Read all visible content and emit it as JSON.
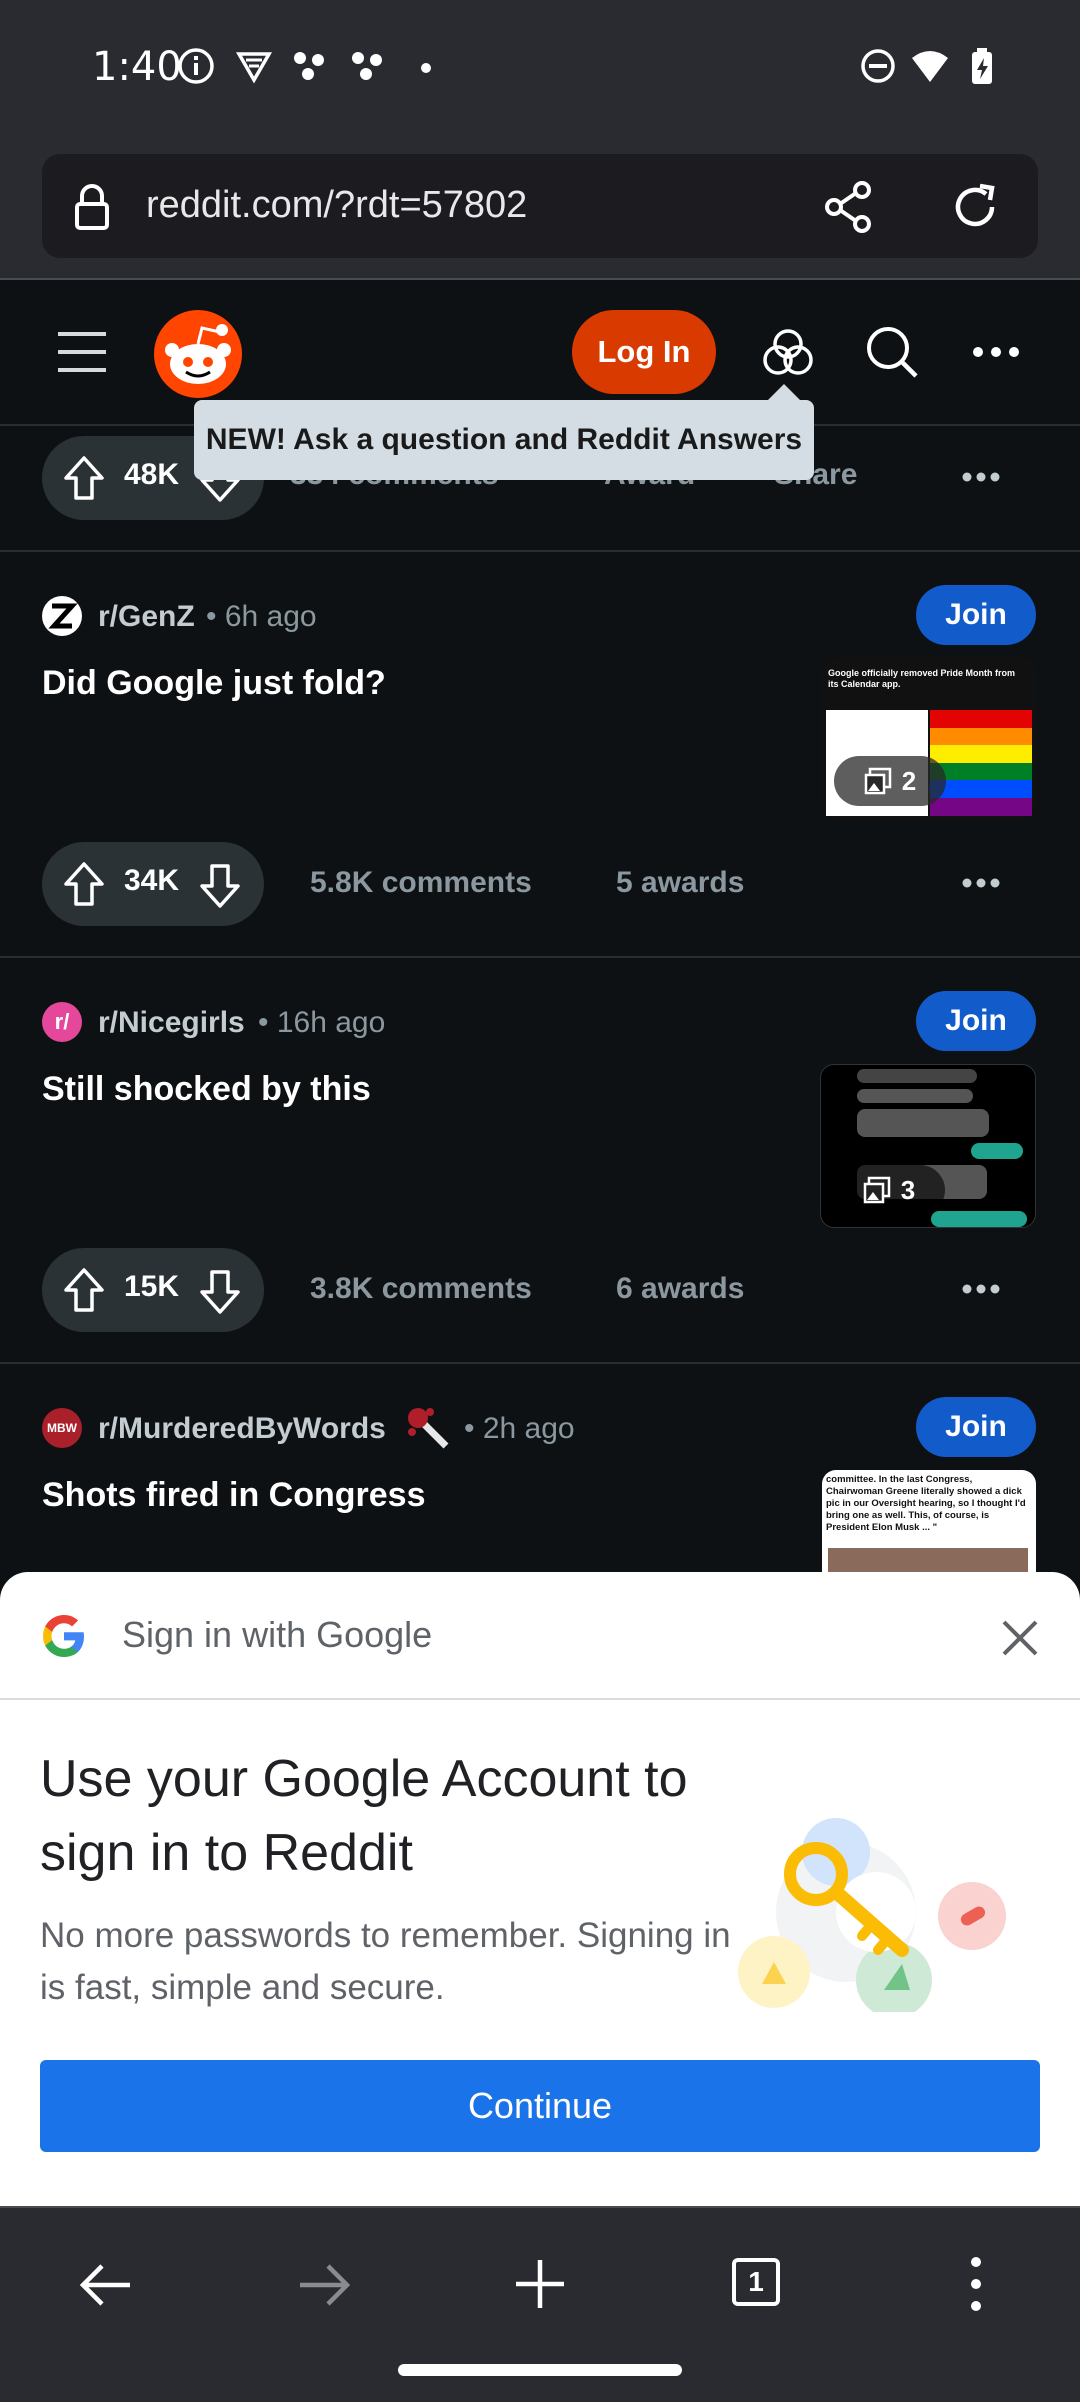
{
  "status_bar": {
    "time": "1:40"
  },
  "browser": {
    "url": "reddit.com/?rdt=57802",
    "tab_count": "1"
  },
  "reddit_header": {
    "login_label": "Log In",
    "tooltip": "NEW! Ask a question and Reddit Answers"
  },
  "partial_post": {
    "votes": "48K",
    "comments": "334 comments",
    "award": "Award",
    "share": "Share"
  },
  "posts": [
    {
      "subreddit": "r/GenZ",
      "age": "6h ago",
      "title": "Did Google just fold?",
      "join_label": "Join",
      "image_count": "2",
      "thumb_text": "Google officially removed Pride Month from its Calendar app.",
      "votes": "34K",
      "comments": "5.8K comments",
      "awards": "5 awards"
    },
    {
      "subreddit": "r/Nicegirls",
      "age": "16h ago",
      "title": "Still shocked by this",
      "join_label": "Join",
      "image_count": "3",
      "votes": "15K",
      "comments": "3.8K comments",
      "awards": "6 awards"
    },
    {
      "subreddit": "r/MurderedByWords",
      "age": "2h ago",
      "title": "Shots fired in Congress",
      "join_label": "Join",
      "thumb_text": "committee. In the last Congress, Chairwoman Greene literally showed a dick pic in our Oversight hearing, so I thought I'd bring one as well. This, of course, is President Elon Musk ... \""
    }
  ],
  "google_signin": {
    "header": "Sign in with Google",
    "headline": "Use your Google Account to sign in to Reddit",
    "subtext": "No more passwords to remember. Signing in is fast, simple and secure.",
    "continue_label": "Continue"
  },
  "colors": {
    "reddit_orange": "#d93a00",
    "join_blue": "#115bca",
    "google_blue": "#1a73e8"
  }
}
